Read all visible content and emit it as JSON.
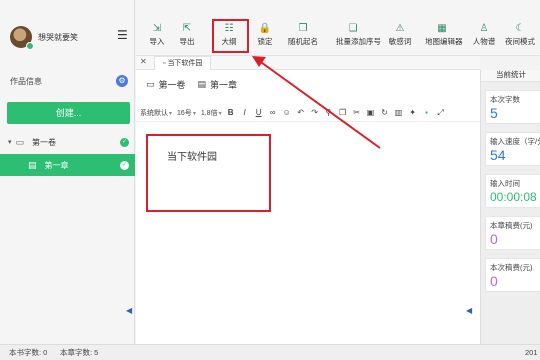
{
  "sidebar": {
    "username": "想哭就要笑",
    "works_info_label": "作品信息",
    "create_label": "创建...",
    "volume_label": "第一卷",
    "chapter_label": "第一章"
  },
  "toolbar": {
    "tools": [
      {
        "label": "导入",
        "icon": "import-icon",
        "glyph": "⇲"
      },
      {
        "label": "导出",
        "icon": "export-icon",
        "glyph": "⇱"
      },
      {
        "label": "大纲",
        "icon": "outline-icon",
        "glyph": "☷"
      },
      {
        "label": "锁定",
        "icon": "lock-icon",
        "glyph": "🔒"
      },
      {
        "label": "随机起名",
        "icon": "random-name-icon",
        "glyph": "❐"
      },
      {
        "label": "批量添加序号",
        "icon": "batch-number-icon",
        "glyph": "❏"
      },
      {
        "label": "敏感词",
        "icon": "sensitive-word-icon",
        "glyph": "⚠"
      },
      {
        "label": "地图编辑器",
        "icon": "map-editor-icon",
        "glyph": "▦"
      },
      {
        "label": "人物谱",
        "icon": "character-icon",
        "glyph": "♙"
      },
      {
        "label": "夜间模式",
        "icon": "night-mode-icon",
        "glyph": "☾"
      }
    ]
  },
  "tabs": {
    "close_glyph": "✕",
    "active_tab": "当下软件园"
  },
  "editor": {
    "breadcrumb_volume": "第一卷",
    "breadcrumb_chapter": "第一章",
    "font_family": "系统默认",
    "font_size": "16号",
    "line_height": "1.8倍",
    "bold": "B",
    "italic": "I",
    "underline": "U",
    "content": "当下软件园"
  },
  "stats": {
    "header": "当前统计",
    "cards": [
      {
        "label": "本次字数",
        "value": "5",
        "color": "#2d7ad8"
      },
      {
        "label": "输入速度（字/分）",
        "value": "54",
        "color": "#2d7ad8"
      },
      {
        "label": "输入时间",
        "value": "00:00:08",
        "color": "#2dbd73"
      },
      {
        "label": "本章稿费(元)",
        "value": "0",
        "color": "#b36ad6"
      },
      {
        "label": "本次稿费(元)",
        "value": "0",
        "color": "#b36ad6"
      }
    ]
  },
  "statusbar": {
    "book_words": "本书字数: 0",
    "chapter_words": "本章字数: 5",
    "right_text": "201"
  },
  "colors": {
    "accent_green": "#2dbd73",
    "annotation_red": "#d9202a",
    "settings_blue": "#4a7bd8"
  }
}
